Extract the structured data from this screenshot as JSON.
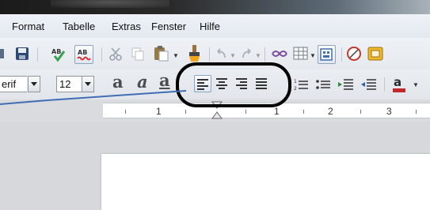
{
  "menubar": {
    "items": [
      {
        "label": "Format"
      },
      {
        "label": "Tabelle"
      },
      {
        "label": "Extras"
      },
      {
        "label": "Fenster"
      },
      {
        "label": "Hilfe"
      }
    ]
  },
  "formatting": {
    "font_name_value": "erif",
    "font_size_value": "12",
    "bold_glyph": "a",
    "italic_glyph": "a",
    "underline_glyph": "a"
  },
  "ruler": {
    "labels": [
      "1",
      "1",
      "2",
      "3"
    ]
  },
  "colors": {
    "annotation_circle": "#000000",
    "annotation_line": "#3f6eb4",
    "active_button_border": "#8ea3bd"
  },
  "icons": [
    "save-icon",
    "spellcheck-icon",
    "autospellcheck-icon",
    "cut-icon",
    "copy-icon",
    "paste-icon",
    "clone-formatting-icon",
    "undo-icon",
    "redo-icon",
    "hyperlink-icon",
    "table-icon",
    "show-draw-functions-icon",
    "navigator-icon",
    "gallery-icon",
    "align-left-icon",
    "align-center-icon",
    "align-right-icon",
    "justify-icon",
    "numbering-icon",
    "bullets-icon",
    "increase-indent-icon",
    "decrease-indent-icon",
    "font-color-icon"
  ]
}
